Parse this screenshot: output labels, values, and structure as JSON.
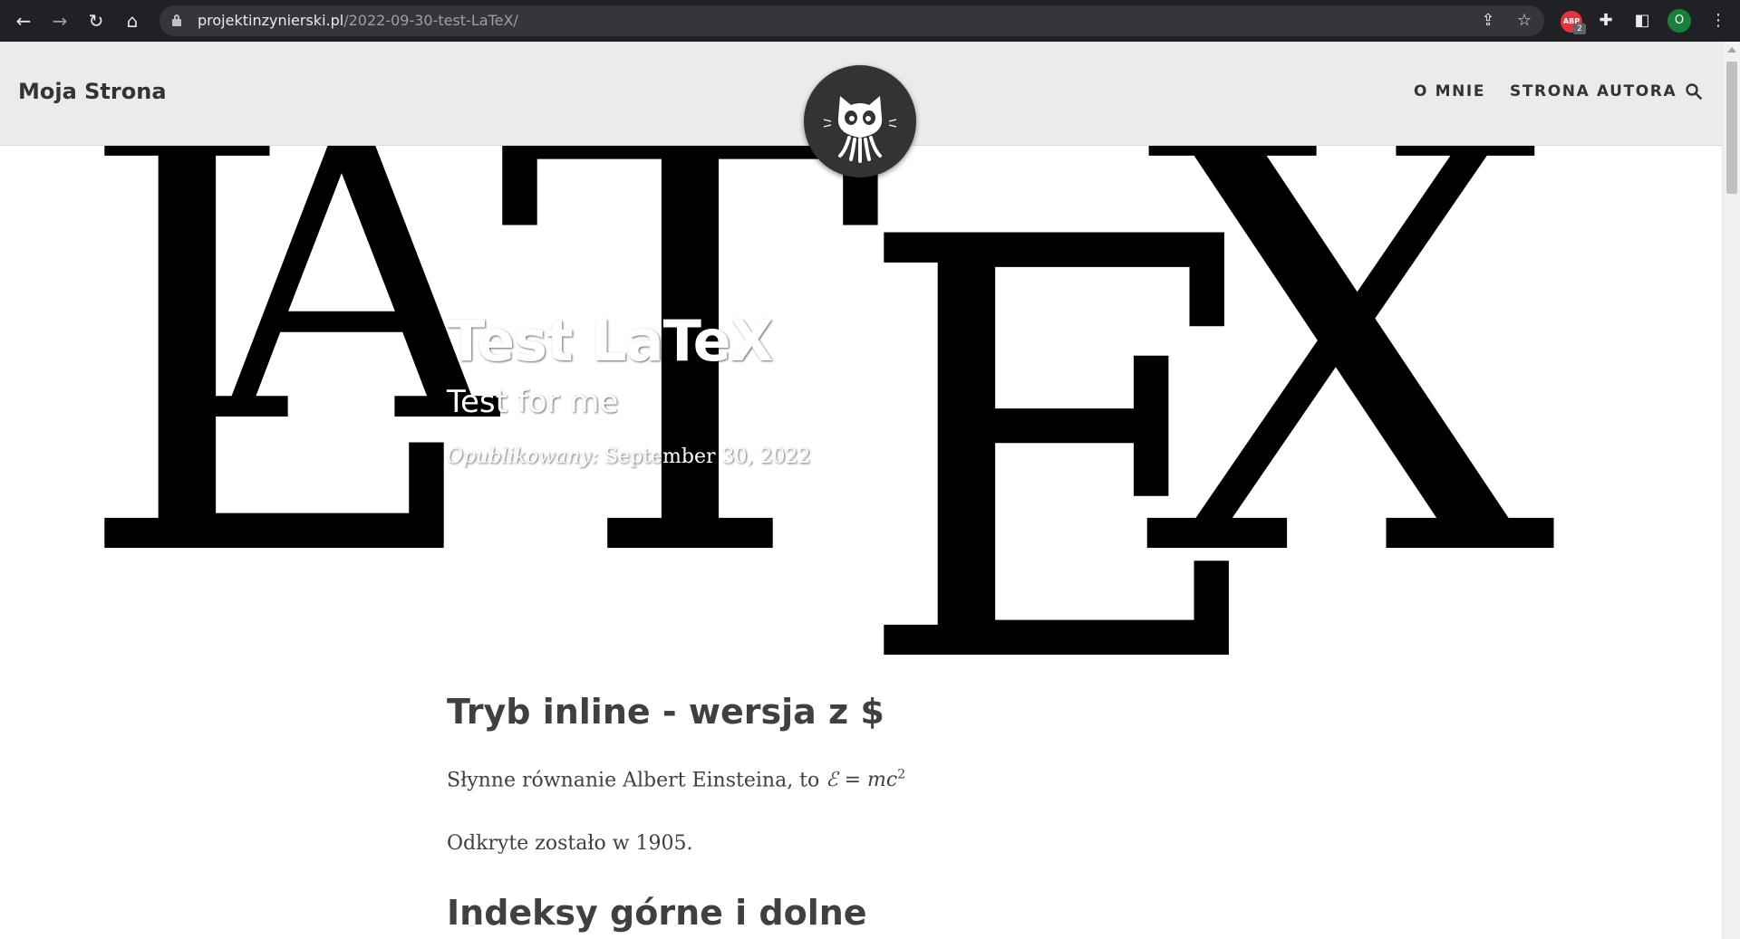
{
  "browser": {
    "url_host": "projektinzynierski.pl",
    "url_path": "/2022-09-30-test-LaTeX/",
    "profile_initial": "O",
    "extension_badge": "2",
    "extension_label": "ABP",
    "icons": [
      "back-arrow-icon",
      "forward-arrow-icon",
      "reload-icon",
      "home-icon",
      "lock-icon",
      "share-icon",
      "star-icon",
      "adblock-icon",
      "puzzle-icon",
      "side-panel-icon",
      "kebab-menu-icon"
    ]
  },
  "site": {
    "brand": "Moja Strona",
    "menu": [
      "O MNIE",
      "STRONA AUTORA"
    ],
    "search_icon": "search-icon",
    "avatar_icon": "github-octocat-icon"
  },
  "hero": {
    "background_text": "LaTeX",
    "title": "Test LaTeX",
    "subtitle": "Test for me",
    "meta_label": "Opublikowany:",
    "meta_date": "September 30, 2022"
  },
  "content": {
    "h1": "Tryb inline - wersja z $",
    "p1_text": "Słynne równanie Albert Einsteina, to",
    "p1_math": "ℰ = mc",
    "p1_math_sup": "2",
    "p2": "Odkryte zostało w 1905.",
    "h2": "Indeksy górne i dolne"
  }
}
